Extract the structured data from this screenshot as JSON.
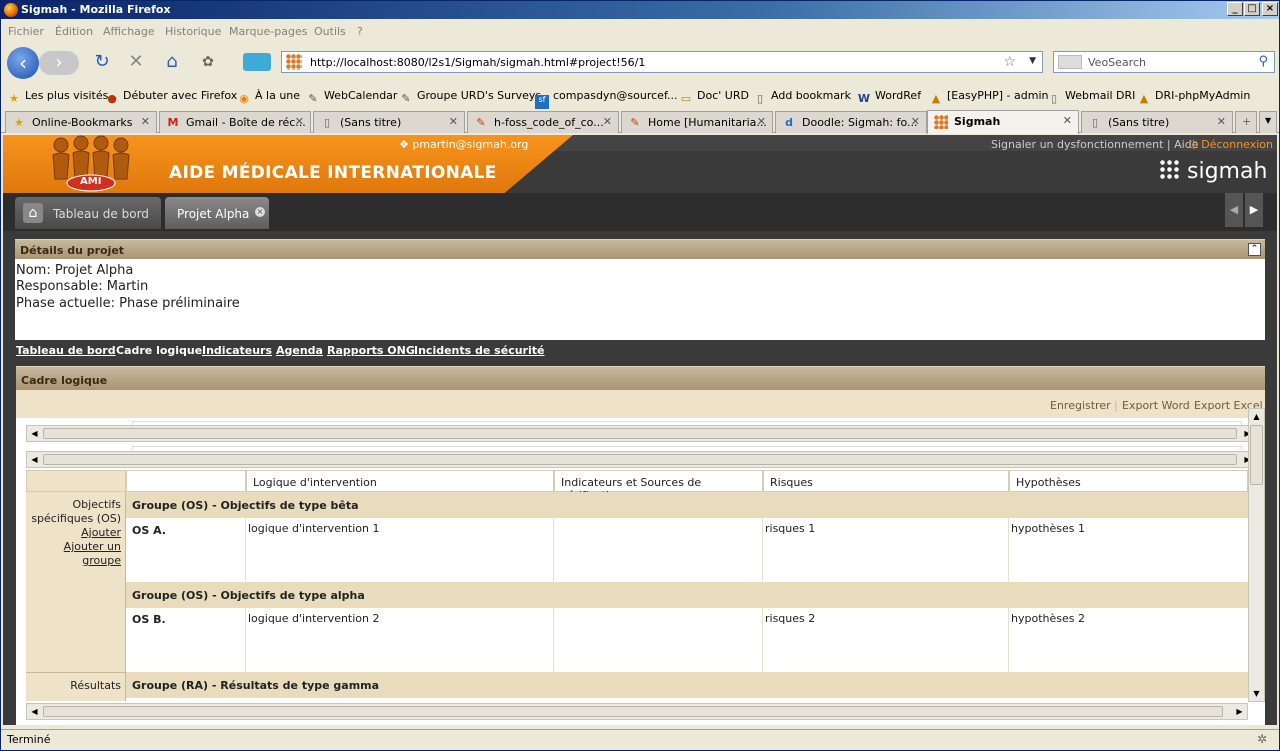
{
  "window": {
    "title": "Sigmah - Mozilla Firefox"
  },
  "menu": [
    "Fichier",
    "Édition",
    "Affichage",
    "Historique",
    "Marque-pages",
    "Outils",
    "?"
  ],
  "navigation": {
    "url": "http://localhost:8080/l2s1/Sigmah/sigmah.html#project!56/1",
    "search_placeholder": "VeoSearch"
  },
  "bookmarks": [
    "Les plus visités",
    "Débuter avec Firefox",
    "À la une",
    "WebCalendar",
    "Groupe URD's Surveys",
    "compasdyn@sourcef...",
    "Doc' URD",
    "Add  bookmark",
    "WordRef",
    "[EasyPHP] - admin",
    "Webmail DRI",
    "DRI-phpMyAdmin"
  ],
  "browser_tabs": [
    {
      "label": "Online-Bookmarks",
      "icon": "star-icon"
    },
    {
      "label": "Gmail - Boîte de réc...",
      "icon": "gmail-icon"
    },
    {
      "label": "(Sans titre)",
      "icon": "page-icon"
    },
    {
      "label": "h-foss_code_of_co...",
      "icon": "edit-icon"
    },
    {
      "label": "Home [Humanitaria...",
      "icon": "edit-icon"
    },
    {
      "label": "Doodle: Sigmah: fo...",
      "icon": "doodle-icon"
    },
    {
      "label": "Sigmah",
      "icon": "sigmah-icon",
      "active": true
    },
    {
      "label": "(Sans titre)",
      "icon": "page-icon"
    }
  ],
  "app": {
    "org_name": "AIDE MÉDICALE INTERNATIONALE",
    "logo_text": "AMI",
    "user_email": "pmartin@sigmah.org",
    "top_links": "Signaler un dysfonctionnement | Aide",
    "logout": "Déconnexion",
    "brand": "sigmah",
    "tabs": [
      {
        "label": "Tableau de bord",
        "icon": "home-icon"
      },
      {
        "label": "Projet Alpha",
        "closable": true
      }
    ]
  },
  "details": {
    "title": "Détails du projet",
    "lines": [
      "Nom: Projet Alpha",
      "Responsable: Martin",
      "Phase actuelle: Phase préliminaire"
    ]
  },
  "subnav": [
    {
      "label": "Tableau de bord",
      "link": true
    },
    {
      "label": "Cadre logique",
      "link": false
    },
    {
      "label": "Indicateurs",
      "link": true
    },
    {
      "label": "Agenda",
      "link": true
    },
    {
      "label": "Rapports ONG",
      "link": true
    },
    {
      "label": "Incidents de sécurité",
      "link": true
    }
  ],
  "logframe": {
    "title": "Cadre logique",
    "toolbar": [
      "Enregistrer",
      "Export Word",
      "Export Excel"
    ],
    "columns": [
      "Logique d'intervention",
      "Indicateurs et Sources de vérification",
      "Risques",
      "Hypothèses"
    ],
    "sections": [
      {
        "side_label": "Objectifs spécifiques (OS)",
        "side_links": [
          "Ajouter",
          "Ajouter un groupe"
        ],
        "groups": [
          {
            "title": "Groupe (OS) - Objectifs de type bêta",
            "rows": [
              {
                "code": "OS A.",
                "logic": "logique d'intervention 1",
                "indicators": "",
                "risks": "risques 1",
                "hypotheses": "hypothèses 1"
              }
            ]
          },
          {
            "title": "Groupe (OS) - Objectifs de type alpha",
            "rows": [
              {
                "code": "OS B.",
                "logic": "logique d'intervention 2",
                "indicators": "",
                "risks": "risques 2",
                "hypotheses": "hypothèses 2"
              }
            ]
          }
        ]
      },
      {
        "side_label": "Résultats",
        "groups": [
          {
            "title": "Groupe (RA) - Résultats de type gamma",
            "rows": []
          }
        ]
      }
    ]
  },
  "status": "Terminé"
}
